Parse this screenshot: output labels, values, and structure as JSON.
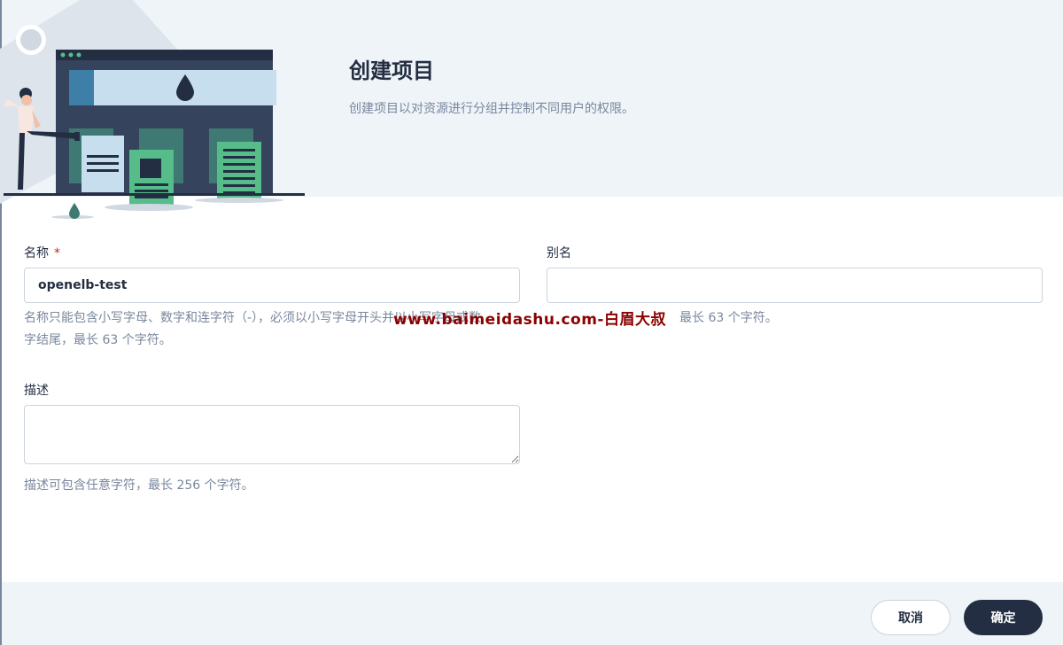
{
  "header": {
    "title": "创建项目",
    "subtitle": "创建项目以对资源进行分组并控制不同用户的权限。"
  },
  "form": {
    "name": {
      "label": "名称",
      "required_mark": "*",
      "value": "openelb-test",
      "hint_line1": "名称只能包含小写字母、数字和连字符（-），必须以小写字母开头并以小写字母或数",
      "hint_line2": "字结尾，最长 63 个字符。"
    },
    "alias": {
      "label": "别名",
      "value": "",
      "hint": "最长 63 个字符。"
    },
    "description": {
      "label": "描述",
      "value": "",
      "hint": "描述可包含任意字符，最长 256 个字符。"
    }
  },
  "watermark": "www.baimeidashu.com-白眉大叔",
  "footer": {
    "cancel_label": "取消",
    "ok_label": "确定"
  },
  "colors": {
    "primary": "#242e42",
    "header_bg": "#eff4f9",
    "hint": "#79879c",
    "required": "#ca2621",
    "illustration_green": "#55bc8a"
  }
}
